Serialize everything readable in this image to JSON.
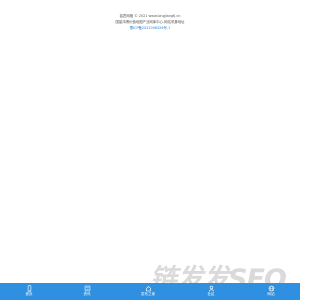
{
  "footer": {
    "line1": "铭匠网格 © 2021 www.longjiangfj.cn",
    "line2": "国星鸿博价值地图产业网库中心-网站采集地址",
    "icp_link": "蜀ICP备2021006326号-1"
  },
  "tabbar": {
    "background": "#2f8fe0",
    "items": [
      {
        "label": "首页",
        "icon": "home-icon"
      },
      {
        "label": "资讯",
        "icon": "news-icon"
      },
      {
        "label": "发布之家",
        "icon": "publish-icon"
      },
      {
        "label": "社区",
        "icon": "community-icon"
      },
      {
        "label": "网站",
        "icon": "website-icon"
      }
    ]
  },
  "watermark": "链发发SEO"
}
